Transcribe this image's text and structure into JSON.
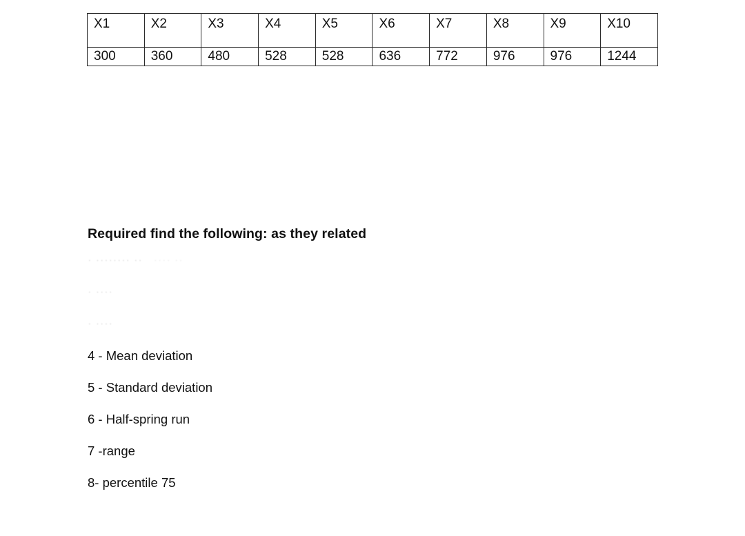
{
  "document": {
    "background_color": "#ffffff",
    "text_color": "#111111",
    "table_border_color": "#2b2b2b"
  },
  "table": {
    "headers": [
      "X1",
      "X2",
      "X3",
      "X4",
      "X5",
      "X6",
      "X7",
      "X8",
      "X9",
      "X10"
    ],
    "values": [
      "300",
      "360",
      "480",
      "528",
      "528",
      "636",
      "772",
      "976",
      "976",
      "1244"
    ]
  },
  "requirements": {
    "heading": "Required find the following:  as they related",
    "items": [
      {
        "text": "",
        "ghost_a": "· ········ ··",
        "ghost_b": "···· ··",
        "legible": false
      },
      {
        "text": "",
        "ghost_a": "· ····",
        "ghost_b": "",
        "legible": false
      },
      {
        "text": "",
        "ghost_a": "· ····",
        "ghost_b": "",
        "legible": false
      },
      {
        "text": "4 - Mean deviation",
        "legible": true
      },
      {
        "text": "5 - Standard deviation",
        "legible": true
      },
      {
        "text": "6 - Half-spring run",
        "legible": true
      },
      {
        "text": "7 -range",
        "legible": true
      },
      {
        "text": "8- percentile 75",
        "legible": true
      }
    ]
  }
}
